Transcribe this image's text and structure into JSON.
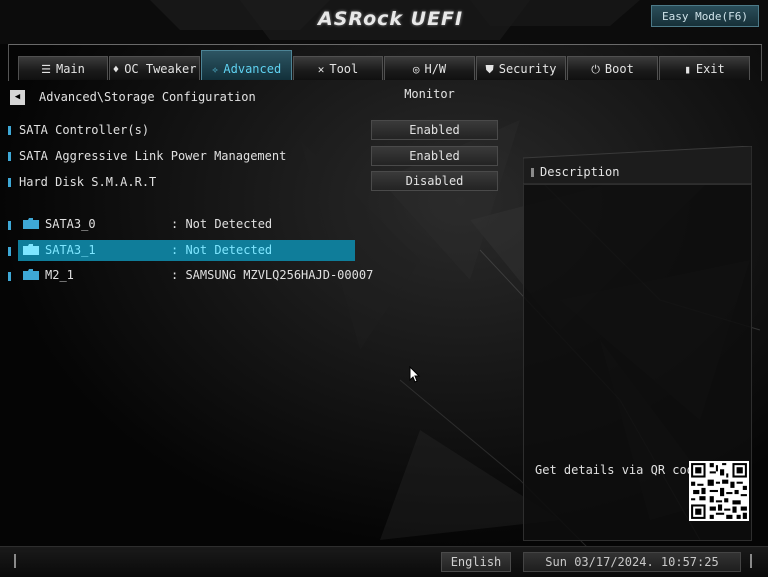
{
  "header": {
    "logo_text": "ASRock UEFI",
    "easy_mode_label": "Easy Mode(F6)"
  },
  "tabs": [
    {
      "label": "Main",
      "icon": "list-icon",
      "active": false
    },
    {
      "label": "OC Tweaker",
      "icon": "flame-icon",
      "active": false
    },
    {
      "label": "Advanced",
      "icon": "star-icon",
      "active": true
    },
    {
      "label": "Tool",
      "icon": "tools-icon",
      "active": false
    },
    {
      "label": "H/W Monitor",
      "icon": "monitor-icon",
      "active": false
    },
    {
      "label": "Security",
      "icon": "shield-icon",
      "active": false
    },
    {
      "label": "Boot",
      "icon": "power-icon",
      "active": false
    },
    {
      "label": "Exit",
      "icon": "exit-icon",
      "active": false
    }
  ],
  "breadcrumb": "Advanced\\Storage Configuration",
  "settings": [
    {
      "label": "SATA Controller(s)",
      "value": "Enabled"
    },
    {
      "label": "SATA Aggressive Link Power Management",
      "value": "Enabled"
    },
    {
      "label": "Hard Disk S.M.A.R.T",
      "value": "Disabled"
    }
  ],
  "devices": [
    {
      "name": "SATA3_0",
      "value": ": Not Detected",
      "selected": false
    },
    {
      "name": "SATA3_1",
      "value": ": Not Detected",
      "selected": true
    },
    {
      "name": "M2_1",
      "value": ": SAMSUNG MZVLQ256HAJD-00007",
      "selected": false
    }
  ],
  "description": {
    "title": "Description",
    "qr_text": "Get details via QR code"
  },
  "footer": {
    "language": "English",
    "datetime": "Sun 03/17/2024. 10:57:25"
  },
  "colors": {
    "accent": "#0f7d9a",
    "accent_text": "#5fd1f0",
    "marker": "#3ea8d6"
  }
}
